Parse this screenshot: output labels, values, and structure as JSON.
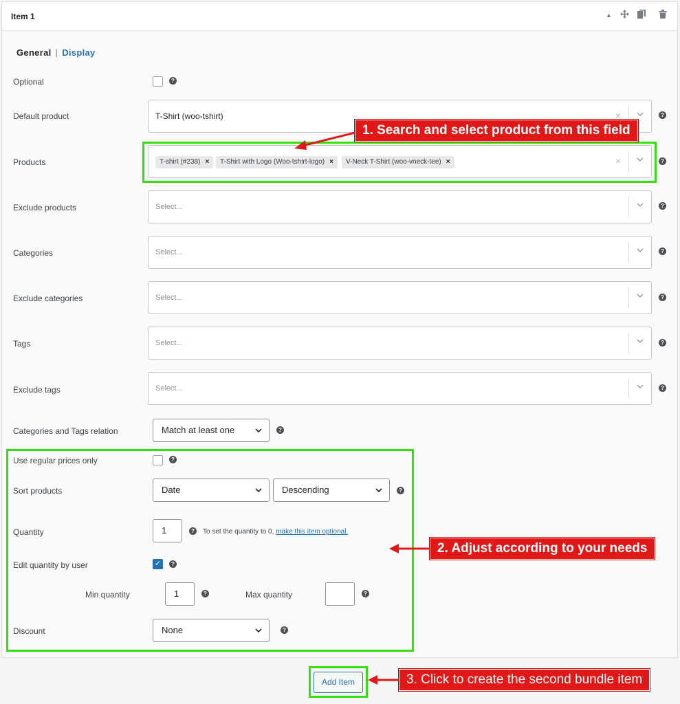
{
  "header": {
    "title": "Item 1",
    "icons": [
      "collapse-up-icon",
      "move-icon",
      "duplicate-icon",
      "trash-icon"
    ]
  },
  "tabs": {
    "general": "General",
    "separator": "|",
    "display": "Display"
  },
  "fields": {
    "optional": {
      "label": "Optional",
      "checked": false
    },
    "default_product": {
      "label": "Default product",
      "value": "T-Shirt (woo-tshirt)",
      "clear": "×"
    },
    "products": {
      "label": "Products",
      "chips": [
        "T-shirt (#238)",
        "T-Shirt with Logo (Woo-tshirt-logo)",
        "V-Neck T-Shirt (woo-vneck-tee)"
      ],
      "chip_remove": "×",
      "clear": "×"
    },
    "exclude_products": {
      "label": "Exclude products",
      "placeholder": "Select..."
    },
    "categories": {
      "label": "Categories",
      "placeholder": "Select..."
    },
    "exclude_categories": {
      "label": "Exclude categories",
      "placeholder": "Select..."
    },
    "tags": {
      "label": "Tags",
      "placeholder": "Select..."
    },
    "exclude_tags": {
      "label": "Exclude tags",
      "placeholder": "Select..."
    },
    "relation": {
      "label": "Categories and Tags relation",
      "value": "Match at least one"
    },
    "regular_prices": {
      "label": "Use regular prices only",
      "checked": false
    },
    "sort": {
      "label": "Sort products",
      "by": "Date",
      "order": "Descending"
    },
    "quantity": {
      "label": "Quantity",
      "value": "1",
      "hint": "To set the quantity to 0,",
      "hint_link": "make this item optional."
    },
    "edit_quantity": {
      "label": "Edit quantity by user",
      "checked": true,
      "check_mark": "✓"
    },
    "min_quantity": {
      "label": "Min quantity",
      "value": "1"
    },
    "max_quantity": {
      "label": "Max quantity",
      "value": ""
    },
    "discount": {
      "label": "Discount",
      "value": "None"
    }
  },
  "help_glyph": "?",
  "add_item_label": "Add Item",
  "annotations": {
    "step1": "1. Search and select product from this field",
    "step2": "2. Adjust according to your needs",
    "step3": "3. Click to create the second bundle item"
  },
  "colors": {
    "highlight_green": "#33e00e",
    "callout_red": "#e01818",
    "link_blue": "#2271b1",
    "checkbox_blue": "#2271b1"
  }
}
